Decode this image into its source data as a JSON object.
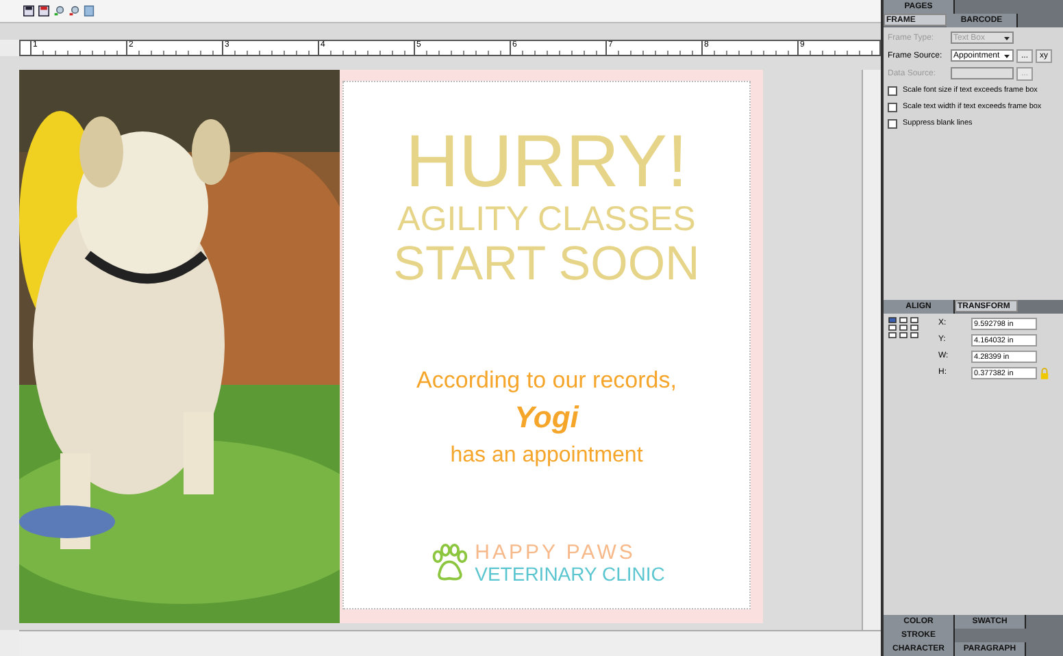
{
  "ruler": {
    "marks": [
      "1",
      "2",
      "3",
      "4",
      "5",
      "6",
      "7",
      "8",
      "9"
    ]
  },
  "card": {
    "headline": "HURRY!",
    "subhead_1": "AGILITY CLASSES",
    "subhead_2": "START SOON",
    "line_1": "According to our records,",
    "name": "Yogi",
    "line_2": "has an appointment",
    "logo_top": "HAPPY PAWS",
    "logo_bottom": "VETERINARY CLINIC"
  },
  "top_tabs": [
    {
      "label": "PAGES",
      "selected": false
    }
  ],
  "frame_tabs": [
    {
      "label": "FRAME",
      "selected": true
    },
    {
      "label": "BARCODE",
      "selected": false
    }
  ],
  "frame_fields": [
    {
      "label": "Frame Type:",
      "value": "Text Box",
      "disabled": true
    },
    {
      "label": "Frame Source:",
      "value": "Appointment",
      "disabled": false
    },
    {
      "label": "Data Source:",
      "disabled": true
    }
  ],
  "frame_buttons": [
    "...",
    "xy"
  ],
  "data_source_button": "...",
  "options": [
    {
      "label": "Scale font size if text exceeds frame box",
      "checked": false
    },
    {
      "label": "Scale text width if text exceeds frame box",
      "checked": false
    },
    {
      "label": "Suppress blank lines",
      "checked": false
    }
  ],
  "transform_tabs": [
    {
      "label": "ALIGN",
      "selected": false
    },
    {
      "label": "TRANSFORM",
      "selected": true
    }
  ],
  "transform_fields": [
    {
      "label": "X:",
      "value": "9.592798 in"
    },
    {
      "label": "Y:",
      "value": "4.164032 in"
    },
    {
      "label": "W:",
      "value": "4.28399 in"
    },
    {
      "label": "H:",
      "value": "0.377382 in"
    }
  ],
  "bottom_tabs": [
    [
      {
        "label": "COLOR",
        "selected": false
      },
      {
        "label": "SWATCH",
        "selected": false
      }
    ],
    [
      {
        "label": "STROKE",
        "selected": false
      }
    ],
    [
      {
        "label": "CHARACTER",
        "selected": false
      },
      {
        "label": "PARAGRAPH",
        "selected": false
      }
    ]
  ]
}
